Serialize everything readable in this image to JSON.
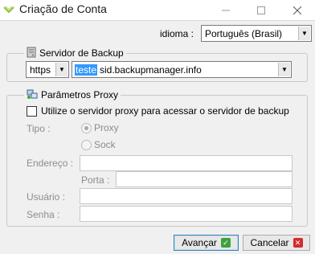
{
  "window": {
    "title": "Criação de Conta",
    "controls": {
      "minimize": "—",
      "maximize": "☐",
      "close": "✕"
    }
  },
  "language": {
    "label": "idioma :",
    "selected": "Português (Brasil)"
  },
  "backup_server": {
    "legend": "Servidor de Backup",
    "protocol": "https",
    "host_selected": "teste",
    "host_rest": "sid.backupmanager.info"
  },
  "proxy": {
    "legend": "Parâmetros Proxy",
    "use_proxy_label": "Utilize o servidor proxy para acessar o servidor de backup",
    "use_proxy_checked": false,
    "type_label": "Tipo :",
    "type_options": [
      "Proxy",
      "Sock"
    ],
    "type_selected": "Proxy",
    "address_label": "Endereço :",
    "address_value": "",
    "port_label": "Porta :",
    "port_value": "",
    "user_label": "Usuário :",
    "user_value": "",
    "password_label": "Senha :",
    "password_value": ""
  },
  "buttons": {
    "next": "Avançar",
    "cancel": "Cancelar"
  },
  "colors": {
    "selection": "#3399ff",
    "ok_green": "#3da33d",
    "cancel_red": "#d62b2b"
  }
}
